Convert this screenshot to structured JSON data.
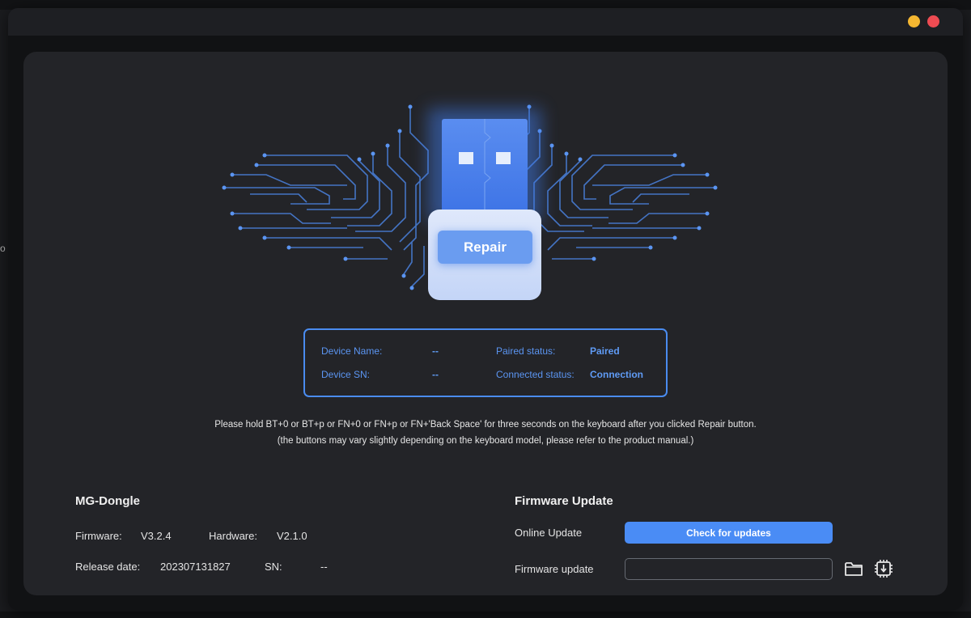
{
  "window": {
    "controls": {
      "minimize_color": "#f5b731",
      "close_color": "#ee4b52"
    }
  },
  "repair": {
    "button_label": "Repair"
  },
  "device_info": {
    "name_label": "Device Name:",
    "name_value": "--",
    "sn_label": "Device SN:",
    "sn_value": "--",
    "paired_label": "Paired status:",
    "paired_value": "Paired",
    "connected_label": "Connected status:",
    "connected_value": "Connection"
  },
  "hint": {
    "line1": "Please hold BT+0 or BT+p or FN+0 or FN+p or FN+'Back Space' for three seconds on the keyboard after you clicked Repair button.",
    "line2": "(the buttons may vary slightly depending on the keyboard model, please refer to the product manual.)"
  },
  "dongle": {
    "title": "MG-Dongle",
    "firmware_label": "Firmware:",
    "firmware_value": "V3.2.4",
    "hardware_label": "Hardware:",
    "hardware_value": "V2.1.0",
    "release_label": "Release date:",
    "release_value": "202307131827",
    "sn_label": "SN:",
    "sn_value": "--"
  },
  "firmware_update": {
    "title": "Firmware Update",
    "online_label": "Online Update",
    "check_button": "Check for updates",
    "file_label": "Firmware update",
    "file_value": "",
    "folder_icon": "folder-icon",
    "flash_icon": "chip-download-icon"
  },
  "colors": {
    "accent": "#4a8cf5",
    "panel": "#232428",
    "background": "#111214"
  },
  "background_app": {
    "edge_text": "o"
  }
}
